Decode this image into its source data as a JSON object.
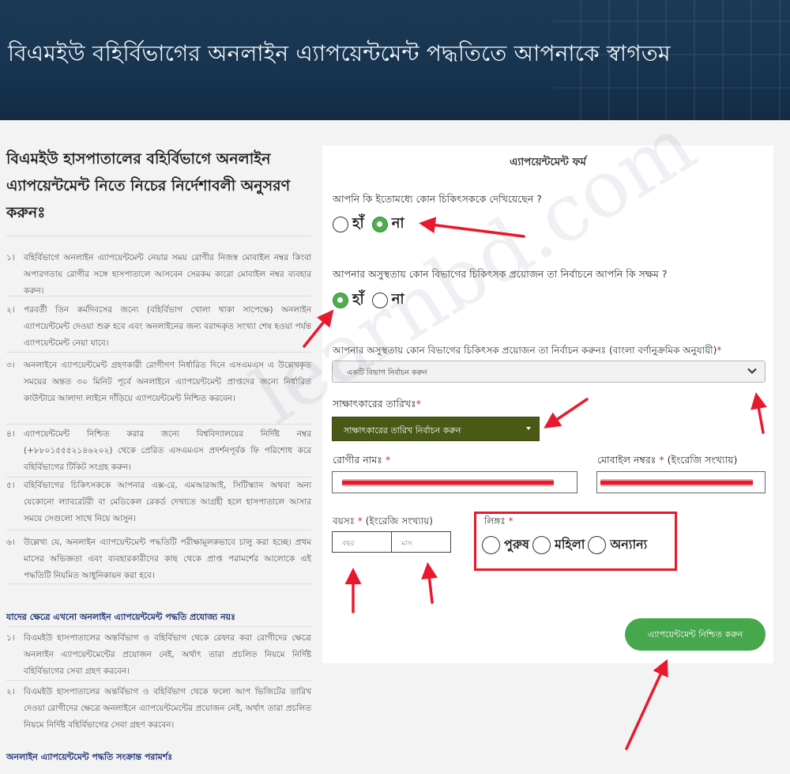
{
  "banner": {
    "title": "বিএমইউ বহির্বিভাগের অনলাইন এ্যাপয়েন্টমেন্ট পদ্ধতিতে আপনাকে স্বাগতম"
  },
  "instructions": {
    "heading": "বিএমইউ হাসপাতালের বহির্বিভাগে অনলাইন এ্যাপয়েন্টমেন্ট নিতে নিচের নির্দেশাবলী অনুসরণ করুনঃ",
    "items": [
      {
        "num": "১।",
        "text": "বহির্বিভাগে অনলাইন এ্যাপয়েন্টমেন্ট নেয়ার সময় রোগীর নিজস্ব মোবাইল নম্বর কিংবা অপারগতায় রোগীর সঙ্গে হাসপাতালে আসবেন সেরকম কারো মোবাইল নম্বর ব্যবহার করুন।"
      },
      {
        "num": "২।",
        "text": "পরবর্তী তিন কর্মদিবসের জন্যে (বহির্বিভাগ খোলা থাকা সাপেক্ষে) অনলাইন এ্যাপয়েন্টমেন্ট দেওয়া শুরু হবে এবং অনলাইনের জন্য বরাদ্দকৃত সংখ্যা শেষ হওয়া পর্যন্ত এ্যাপয়েন্টমেন্ট নেয়া যাবে।"
      },
      {
        "num": "৩।",
        "text": "অনলাইনে এ্যাপয়েন্টমেন্ট গ্রহণকারী রোগীগণ নির্ধারিত দিনে এসএমএস এ উল্লেখকৃত সময়ের অন্তত ৩০ মিনিট পূর্বে অনলাইনে এ্যাপয়েন্টমেন্ট প্রাপ্তদের জন্যে নির্ধারিত কাউন্টারে আলাদা লাইনে দাঁড়িয়ে এ্যাপয়েন্টমেন্ট নিশ্চিত করবেন।"
      },
      {
        "num": "৪।",
        "text": "এ্যাপয়েন্টমেন্ট নিশ্চিত করার জন্যে বিশ্ববিদ্যালয়ের নির্দিষ্ট নম্বর (+৮৮০১৫৫৫২১৪৬২০২) থেকে প্রেরিত এসএমএস প্রদর্শনপূর্বক ফি পরিশোধ করে বহির্বিভাগের টিকিট সংগ্রহ করুন।"
      },
      {
        "num": "৫।",
        "text": "বহির্বিভাগের চিকিৎসককে আপনার এক্স-রে, এমআরআই, সিটিস্ক্যান অথবা অন্য যেকোনো ল্যাবরেটরী বা মেডিকেল রেকর্ড দেখাতে আগ্রহী হলে হাসপাতালে আসার সময়ে সেগুলো সাথে নিয়ে আসুন।"
      },
      {
        "num": "৬।",
        "text": "উল্লেখ্য যে, অনলাইন এ্যাপয়েন্টমেন্ট পদ্ধতিটি পরীক্ষামূলকভাবে চালু করা হচ্ছে। প্রথম মাসের অভিজ্ঞতা এবং ব্যবহারকারীদের কাছ থেকে প্রাপ্ত পরামর্শের আলোকে এই পদ্ধতিটি নিয়মিত আধুনিকায়ন করা হবে।"
      }
    ],
    "not_applicable_heading": "যাদের ক্ষেত্রে এখনো অনলাইন এ্যাপয়েন্টমেন্ট পদ্ধতি প্রযোজ্য নয়ঃ",
    "not_applicable_items": [
      {
        "num": "১।",
        "text": "বিএমইউ হাসপাতালের অন্তর্বিভাগ ও বহির্বিভাগ থেকে রেফার করা রোগীদের ক্ষেত্রে অনলাইন এ্যাপয়েন্টমেন্টের প্রয়োজন নেই, অর্থাৎ তারা প্রচলিত নিয়মে নির্দিষ্ট বহির্বিভাগের সেবা গ্রহণ করবেন।"
      },
      {
        "num": "২।",
        "text": "বিএমইউ হাসপাতালের অন্তর্বিভাগ ও বহির্বিভাগ থেকে ফলো আপ ভিজিটের তারিখ দেওয়া রোগীদের ক্ষেত্রে অনলাইনে এ্যাপয়েন্টমেন্টের প্রয়োজন নেই, অর্থাৎ তারা প্রচলিত নিয়মে নির্দিষ্ট বহির্বিভাগের সেবা গ্রহণ করবেন।"
      }
    ],
    "advice_heading": "অনলাইন এ্যাপয়েন্টমেন্ট পদ্ধতি সংক্রান্ত পরামর্শঃ"
  },
  "form": {
    "title": "এ্যাপয়েন্টমেন্ট ফর্ম",
    "q1": {
      "label": "আপনি কি ইতোমধ্যে কোন চিকিৎসককে দেখিয়েছেন ?",
      "yes": "হাঁ",
      "no": "না",
      "selected": "no"
    },
    "q2": {
      "label": "আপনার অসুস্থতায় কোন বিভাগের চিকিৎসক প্রয়োজন তা নির্বাচনে আপনি কি সক্ষম ?",
      "yes": "হাঁ",
      "no": "না",
      "selected": "yes"
    },
    "department": {
      "label": "আপনার অসুস্থতায় কোন বিভাগের চিকিৎসক প্রয়োজন তা নির্বাচন করুনঃ (বাংলা বর্ণানুক্রমিক অনুযায়ী)",
      "required": "*",
      "value": "একটি বিভাগ নির্বাচন করুন"
    },
    "date": {
      "label": "সাক্ষাৎকারের তারিখঃ",
      "required": "*",
      "button": "সাক্ষাৎকারের তারিখ নির্বাচন করুন"
    },
    "patient_name": {
      "label": "রোগীর নামঃ",
      "required": "*"
    },
    "mobile": {
      "label": "মোবাইল নম্বরঃ",
      "required": "*",
      "hint": "(ইংরেজি সংখ্যায়)"
    },
    "age": {
      "label": "বয়সঃ",
      "required": "*",
      "hint": "(ইংরেজি সংখ্যায়)",
      "year_placeholder": "বছর",
      "month_placeholder": "মাস"
    },
    "gender": {
      "label": "লিঙ্গঃ",
      "required": "*",
      "options": [
        "পুরুষ",
        "মহিলা",
        "অন্যান্য"
      ]
    },
    "submit": "এ্যাপয়েন্টমেন্ট নিশ্চিত করুন"
  },
  "watermark": "learnbd.com",
  "colors": {
    "banner": "#173450",
    "accent_green": "#46a74d",
    "date_button": "#4a5a16",
    "annotation_red": "#e8192c"
  }
}
